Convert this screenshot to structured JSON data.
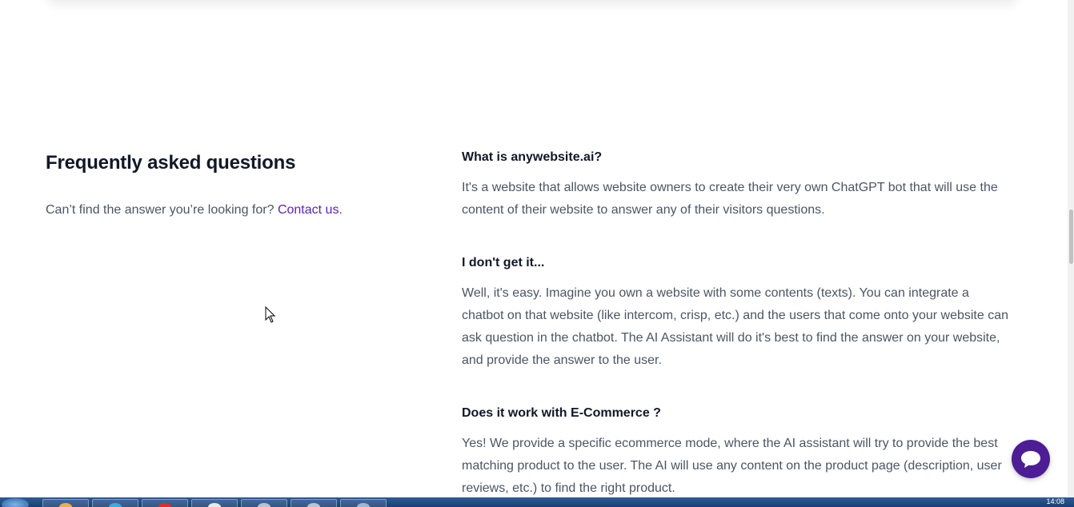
{
  "faq": {
    "title": "Frequently asked questions",
    "subtitle_prefix": "Can’t find the answer you’re looking for?",
    "contact_link": "Contact us",
    "subtitle_suffix": ".",
    "items": [
      {
        "question": "What is anywebsite.ai?",
        "answer": "It's a website that allows website owners to create their very own ChatGPT bot that will use the content of their website to answer any of their visitors questions."
      },
      {
        "question": "I don't get it...",
        "answer": "Well, it's easy. Imagine you own a website with some contents (texts). You can integrate a chatbot on that website (like intercom, crisp, etc.) and the users that come onto your website can ask question in the chatbot. The AI Assistant will do it's best to find the answer on your website, and provide the answer to the user."
      },
      {
        "question": "Does it work with E-Commerce ?",
        "answer": "Yes! We provide a specific ecommerce mode, where the AI assistant will try to provide the best matching product to the user. The AI will use any content on the product page (description, user reviews, etc.) to find the right product."
      }
    ]
  },
  "chat_widget": {
    "icon": "chat-bubble-icon",
    "color": "#4c1d95"
  },
  "taskbar": {
    "clock": "14:08"
  },
  "colors": {
    "link": "#5b21b6",
    "heading": "#111827",
    "body_text": "#4b5563"
  }
}
